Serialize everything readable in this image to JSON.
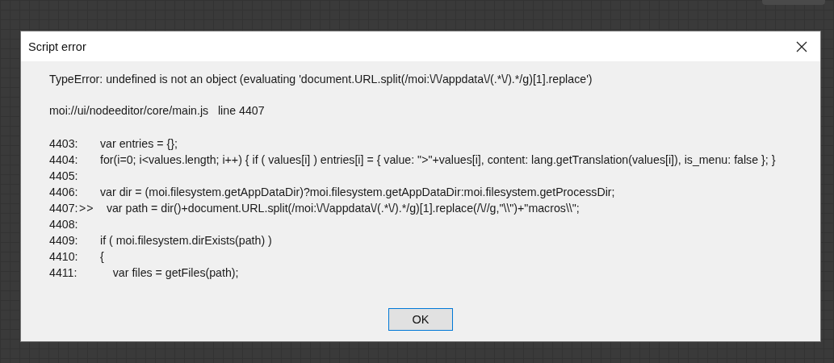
{
  "window": {
    "title": "Script error"
  },
  "message": "TypeError: undefined is not an object (evaluating 'document.URL.split(/moi:\\/\\/appdata\\/(.*\\/).*/g)[1].replace')",
  "location": "moi://ui/nodeeditor/core/main.js   line 4407",
  "code_lines": [
    {
      "number": "4403:",
      "code": "var entries = {};"
    },
    {
      "number": "4404:",
      "code": "for(i=0; i<values.length; i++) { if ( values[i] ) entries[i] = { value: \">\"+values[i], content: lang.getTranslation(values[i]), is_menu: false }; }"
    },
    {
      "number": "4405:"
    },
    {
      "number": "4406:",
      "code": "var dir = (moi.filesystem.getAppDataDir)?moi.filesystem.getAppDataDir:moi.filesystem.getProcessDir;"
    },
    {
      "number": "4407:",
      "marker": ">>",
      "code": "  var path = dir()+document.URL.split(/moi:\\/\\/appdata\\/(.*\\/).*/g)[1].replace(/\\//g,\"\\\\\")+\"macros\\\\\";"
    },
    {
      "number": "4408:"
    },
    {
      "number": "4409:",
      "code": "if ( moi.filesystem.dirExists(path) )"
    },
    {
      "number": "4410:",
      "code": "{"
    },
    {
      "number": "4411:",
      "code": "    var files = getFiles(path);"
    }
  ],
  "buttons": [
    "OK"
  ]
}
